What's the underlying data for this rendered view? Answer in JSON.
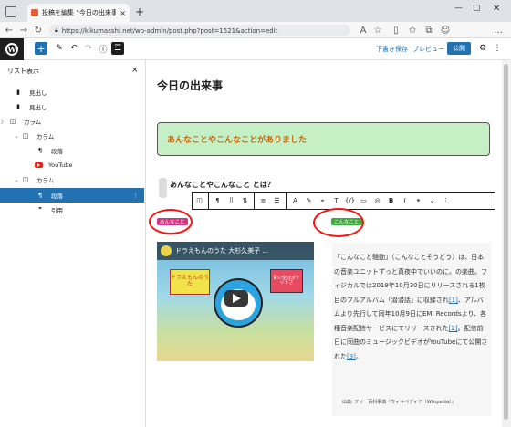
{
  "browser": {
    "tab_title": "投稿を編集 “今日の出来事” ‹ ダウ",
    "url": "https://kikumasshi.net/wp-admin/post.php?post=1521&action=edit"
  },
  "header": {
    "save_draft": "下書き保存",
    "preview": "プレビュー",
    "publish": "公開"
  },
  "sidebar": {
    "title": "リスト表示",
    "close": "×",
    "items": [
      {
        "label": "見出し",
        "icon": "bookmark"
      },
      {
        "label": "見出し",
        "icon": "bookmark"
      },
      {
        "label": "カラム",
        "icon": "columns"
      },
      {
        "label": "カラム",
        "icon": "columns"
      },
      {
        "label": "段落",
        "icon": "pilcrow"
      },
      {
        "label": "YouTube",
        "icon": "youtube"
      },
      {
        "label": "カラム",
        "icon": "columns"
      },
      {
        "label": "段落",
        "icon": "pilcrow"
      },
      {
        "label": "引用",
        "icon": "quote"
      }
    ]
  },
  "editor": {
    "title": "今日の出来事",
    "highlight": "あんなことやこんなことがありました",
    "question": "あんなことやこんなこと とは？",
    "tag_left": "あんなこと",
    "tag_right": "こんなこと",
    "video_title": "ドラえもんのうた 大杉久美子 ...",
    "book1": "ドラえもんのうた",
    "book2": "青い空はポケットさ",
    "para_1": "「こんなこと騒動」（こんなことそうどう）は、日本の音楽ユニットずっと真夜中でいいのに。の楽曲。フィジカルでは2019年10月30日にリリースされる1枚目のフルアルバム「潜潜話」に収録され",
    "para_ref1": "[1]",
    "para_2": "、アルバムより先行して同年10月9日にEMI Recordsより、各種音楽配信サービスにてリリースされた",
    "para_ref2": "[2]",
    "para_3": "。配信前日に同曲のミュージックビデオがYouTubeにて公開された",
    "para_ref3": "[3]",
    "para_4": "。",
    "source": "出典: フリー百科事典『ウィキペディア（Wikipedia）』"
  },
  "colors": {
    "accent": "#2271b1",
    "highlight_bg": "#c5f0c6",
    "highlight_text": "#c6680c",
    "annotation": "#ff1010"
  }
}
